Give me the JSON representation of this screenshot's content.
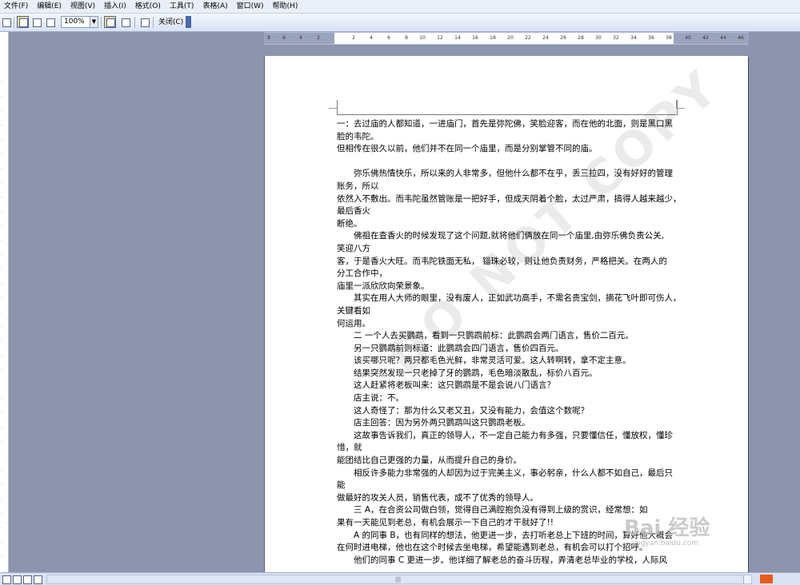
{
  "menu": [
    "文件(F)",
    "编辑(E)",
    "视图(V)",
    "插入(I)",
    "格式(O)",
    "工具(T)",
    "表格(A)",
    "窗口(W)",
    "帮助(H)"
  ],
  "toolbar": {
    "zoom_value": "100%",
    "close_label": "关闭(C)"
  },
  "ruler": {
    "ticks": [
      "8",
      "6",
      "4",
      "2",
      "2",
      "4",
      "6",
      "8",
      "10",
      "12",
      "14",
      "16",
      "18",
      "20",
      "22",
      "24",
      "26",
      "28",
      "30",
      "32",
      "34",
      "36",
      "38",
      "40",
      "42",
      "44",
      "46",
      "48"
    ]
  },
  "document": {
    "lines": [
      {
        "t": "一：去过庙的人都知道，一进庙门，首先是弥陀佛，笑脸迎客，而在他的北面，则是黑口黑",
        "i": false
      },
      {
        "t": "脸的韦陀。",
        "i": false
      },
      {
        "t": "但相传在很久以前，他们并不在同一个庙里，而是分别掌管不同的庙。",
        "i": false
      },
      {
        "t": "",
        "i": false
      },
      {
        "t": "弥乐佛热情快乐，所以来的人非常多，但他什么都不在乎，丢三拉四，没有好好的管理",
        "i": true
      },
      {
        "t": "账务，所以",
        "i": false
      },
      {
        "t": "依然入不敷出。而韦陀虽然管账是一把好手，但成天阴着个脸，太过严肃，搞得人越来越少，",
        "i": false
      },
      {
        "t": "最后香火",
        "i": false
      },
      {
        "t": "断绝。",
        "i": false
      },
      {
        "t": "佛祖在查香火的时候发现了这个问题,就将他们俩放在同一个庙里,由弥乐佛负责公关,",
        "i": true
      },
      {
        "t": "笑迎八方",
        "i": false
      },
      {
        "t": "客，于是香火大旺。而韦陀铁面无私，  锱珠必较，则让他负责财务，严格把关。在两人的",
        "i": false
      },
      {
        "t": "分工合作中，",
        "i": false
      },
      {
        "t": "庙里一派欣欣向荣景象。",
        "i": false
      },
      {
        "t": "其实在用人大师的眼里，没有废人，正如武功高手，不需名贵宝剑，摘花飞叶即可伤人，",
        "i": true
      },
      {
        "t": "关键看如",
        "i": false
      },
      {
        "t": "何运用。",
        "i": false
      },
      {
        "t": "二     一个人去买鹦鹉，看到一只鹦鹉前标：此鹦鹉会两门语言，售价二百元。",
        "i": true
      },
      {
        "t": "另一只鹦鹉前则标道：此鹦鹉会四门语言，售价四百元。",
        "i": true
      },
      {
        "t": "该买哪只呢？两只都毛色光鲜，非常灵活可爱。这人转啊转，拿不定主意。",
        "i": true
      },
      {
        "t": "结果突然发现一只老掉了牙的鹦鹉，毛色暗淡散乱，标价八百元。",
        "i": true
      },
      {
        "t": "这人赶紧将老板叫来：这只鹦鹉是不是会说八门语言？",
        "i": true
      },
      {
        "t": "店主说：不。",
        "i": true
      },
      {
        "t": "这人奇怪了：那为什么又老又丑，又没有能力，会值这个数呢？",
        "i": true
      },
      {
        "t": "店主回答：因为另外两只鹦鹉叫这只鹦鹉老板。",
        "i": true
      },
      {
        "t": "这故事告诉我们，真正的领导人，不一定自己能力有多强，只要懂信任，懂放权，懂珍",
        "i": true
      },
      {
        "t": "惜，就",
        "i": false
      },
      {
        "t": "能团结比自己更强的力量，从而提升自己的身价。",
        "i": false
      },
      {
        "t": "相反许多能力非常强的人却因为过于完美主义，事必躬亲，什么人都不如自己，最后只",
        "i": true
      },
      {
        "t": "能",
        "i": false
      },
      {
        "t": "做最好的攻关人员，销售代表，成不了优秀的领导人。",
        "i": false
      },
      {
        "t": "三     A，在合资公司做白领，觉得自己满腔抱负没有得到上级的赏识，经常想：如",
        "i": true
      },
      {
        "t": "果有一天能见到老总，有机会展示一下自己的才干就好了!!",
        "i": false
      },
      {
        "t": "A 的同事 B，也有同样的想法，他更进一步，去打听老总上下班的时间，算好他大概会",
        "i": true
      },
      {
        "t": "在何时进电梯，他也在这个时候去坐电梯，希望能遇到老总，有机会可以打个招呼。",
        "i": false
      },
      {
        "t": "他们的同事 C 更进一步。他详细了解老总的奋斗历程，弄清老总毕业的学校，人际风",
        "i": true
      }
    ],
    "watermark": "DO NOT COPY"
  },
  "brand": {
    "name": "Bai 经验",
    "url": "jingyan.baidu.com"
  }
}
